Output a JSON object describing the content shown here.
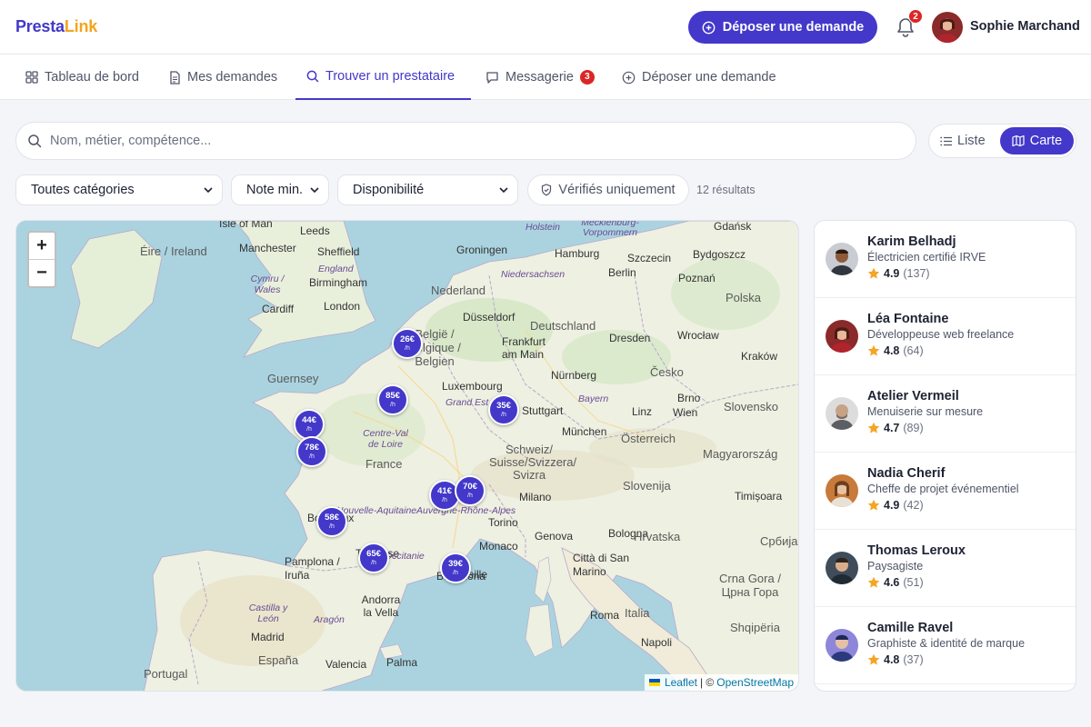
{
  "app": {
    "logo_part1": "Presta",
    "logo_part2": "Link",
    "brand_color": "#4338ca",
    "accent_color": "#f2a51e"
  },
  "header": {
    "cta_label": "Déposer une demande",
    "notifications_count": "2",
    "user_name": "Sophie Marchand",
    "bell_icon": "bell-icon"
  },
  "nav": {
    "tabs": [
      {
        "label": "Tableau de bord",
        "icon": "grid-icon",
        "active": false
      },
      {
        "label": "Mes demandes",
        "icon": "document-icon",
        "active": false
      },
      {
        "label": "Trouver un prestataire",
        "icon": "search-icon",
        "active": true
      },
      {
        "label": "Messagerie",
        "icon": "chat-icon",
        "badge": "3",
        "active": false
      },
      {
        "label": "Déposer une demande",
        "icon": "plus-circle-icon",
        "active": false
      }
    ]
  },
  "search": {
    "placeholder": "Nom, métier, compétence...",
    "value": ""
  },
  "view_toggle": {
    "list_label": "Liste",
    "map_label": "Carte",
    "selected": "Carte"
  },
  "filters": {
    "category": "Toutes catégories",
    "rating": "Note min.",
    "availability": "Disponibilité",
    "verified_label": "Vérifiés uniquement",
    "results": "12 résultats"
  },
  "map": {
    "zoom_in": "+",
    "zoom_out": "−",
    "attribution_leaflet": "Leaflet",
    "attribution_sep": "| ©",
    "attribution_osm": "OpenStreetMap",
    "markers": [
      {
        "price": "26€",
        "unit": "/h"
      },
      {
        "price": "85€",
        "unit": "/h"
      },
      {
        "price": "35€",
        "unit": "/h"
      },
      {
        "price": "44€",
        "unit": "/h"
      },
      {
        "price": "78€",
        "unit": "/h"
      },
      {
        "price": "41€",
        "unit": "/h"
      },
      {
        "price": "70€",
        "unit": "/h"
      },
      {
        "price": "58€",
        "unit": "/h"
      },
      {
        "price": "65€",
        "unit": "/h"
      },
      {
        "price": "39€",
        "unit": "/h"
      }
    ],
    "labels": [
      "Isle of Man",
      "Leeds",
      "Éire / Ireland",
      "Manchester",
      "Sheffield",
      "England",
      "Cymru / Wales",
      "Birmingham",
      "Cardiff",
      "London",
      "Guernsey",
      "Groningen",
      "Hamburg",
      "Niedersachsen",
      "Nederland",
      "Düsseldorf",
      "Deutschland",
      "België / Belgique / Belgien",
      "Frankfurt am Main",
      "Luxembourg",
      "Grand Est",
      "Nürnberg",
      "Stuttgart",
      "Bayern",
      "München",
      "Dresden",
      "Berlin",
      "Szczecin",
      "Bydgoszcz",
      "Gdańsk",
      "Holstein",
      "Mecklenburg-Vorpommern",
      "Poznań",
      "Polska",
      "Wrocław",
      "Kraków",
      "Česko",
      "Brno",
      "Linz",
      "Wien",
      "Österreich",
      "Slovensko",
      "Magyarország",
      "France",
      "Centre-Val de Loire",
      "Schweiz/ Suisse/Svizzera/ Svizra",
      "Milano",
      "Torino",
      "Genova",
      "Bologna",
      "Slovenija",
      "Hrvatska",
      "Timișoara",
      "Србија",
      "Italia",
      "Città di San Marino",
      "Roma",
      "Napoli",
      "Monaco",
      "Marseille",
      "Toulouse",
      "Bordeaux",
      "Pamplona / Iruña",
      "Andorra la Vella",
      "Barcelona",
      "Castilla y León",
      "Aragón",
      "Madrid",
      "España",
      "Portugal",
      "Valencia",
      "Palma",
      "Crna Gora / Црна Гора",
      "Shqipëria",
      "Auvergne-Rhône-Alpes",
      "Nouvelle-Aquitaine",
      "Occitanie"
    ]
  },
  "providers": [
    {
      "name": "Karim Belhadj",
      "job": "Électricien certifié IRVE",
      "rating": "4.9",
      "reviews": "(137)",
      "avatar": "avatar-icon"
    },
    {
      "name": "Léa Fontaine",
      "job": "Développeuse web freelance",
      "rating": "4.8",
      "reviews": "(64)",
      "avatar": "avatar-icon"
    },
    {
      "name": "Atelier Vermeil",
      "job": "Menuiserie sur mesure",
      "rating": "4.7",
      "reviews": "(89)",
      "avatar": "avatar-icon"
    },
    {
      "name": "Nadia Cherif",
      "job": "Cheffe de projet événementiel",
      "rating": "4.9",
      "reviews": "(42)",
      "avatar": "avatar-icon"
    },
    {
      "name": "Thomas Leroux",
      "job": "Paysagiste",
      "rating": "4.6",
      "reviews": "(51)",
      "avatar": "avatar-icon"
    },
    {
      "name": "Camille Ravel",
      "job": "Graphiste & identité de marque",
      "rating": "4.8",
      "reviews": "(37)",
      "avatar": "avatar-icon"
    }
  ]
}
